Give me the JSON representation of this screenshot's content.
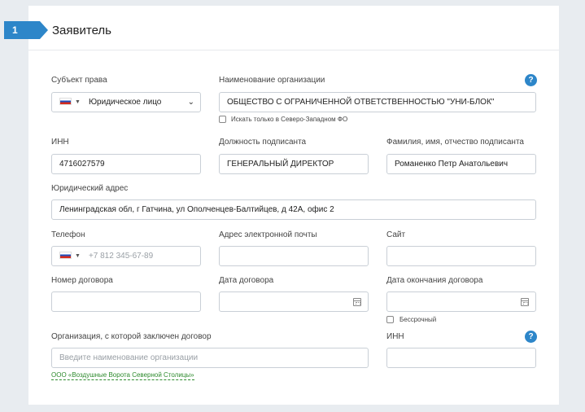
{
  "step": {
    "number": "1",
    "title": "Заявитель"
  },
  "subject": {
    "label": "Субъект права",
    "value": "Юридическое лицо",
    "flag_caret": "▼",
    "chevron": "⌄"
  },
  "org_name": {
    "label": "Наименование организации",
    "value": "ОБЩЕСТВО С ОГРАНИЧЕННОЙ ОТВЕТСТВЕННОСТЬЮ \"УНИ-БЛОК\"",
    "checkbox_label": "Искать только в Северо-Западном ФО",
    "help": "?"
  },
  "inn": {
    "label": "ИНН",
    "value": "4716027579"
  },
  "signer_position": {
    "label": "Должность подписанта",
    "value": "ГЕНЕРАЛЬНЫЙ ДИРЕКТОР"
  },
  "signer_name": {
    "label": "Фамилия, имя, отчество подписанта",
    "value": "Романенко Петр Анатольевич"
  },
  "legal_address": {
    "label": "Юридический адрес",
    "value": "Ленинградская обл, г Гатчина, ул Ополченцев-Балтийцев, д 42А, офис 2"
  },
  "phone": {
    "label": "Телефон",
    "placeholder": "+7 812 345-67-89",
    "flag_caret": "▼"
  },
  "email": {
    "label": "Адрес электронной почты",
    "value": ""
  },
  "site": {
    "label": "Сайт",
    "value": ""
  },
  "contract_number": {
    "label": "Номер договора",
    "value": ""
  },
  "contract_date": {
    "label": "Дата договора",
    "value": ""
  },
  "contract_end_date": {
    "label": "Дата окончания договора",
    "value": "",
    "checkbox_label": "Бессрочный"
  },
  "contract_org": {
    "label": "Организация, с которой заключен договор",
    "placeholder": "Введите наименование организации",
    "suggestion": "ООО «Воздушные Ворота Северной Столицы»"
  },
  "contract_org_inn": {
    "label": "ИНН",
    "value": "",
    "help": "?"
  }
}
